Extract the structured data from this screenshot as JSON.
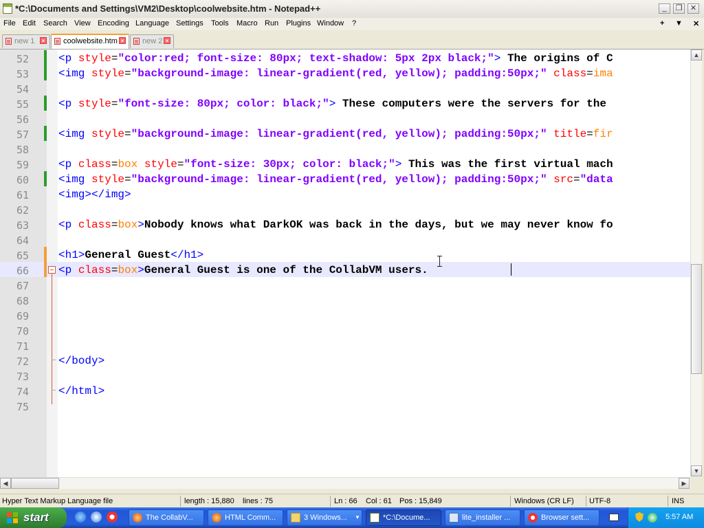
{
  "window": {
    "title": "*C:\\Documents and Settings\\VM2\\Desktop\\coolwebsite.htm - Notepad++",
    "minimize": "_",
    "maximize": "❐",
    "close": "✕"
  },
  "menu": [
    "File",
    "Edit",
    "Search",
    "View",
    "Encoding",
    "Language",
    "Settings",
    "Tools",
    "Macro",
    "Run",
    "Plugins",
    "Window",
    "?"
  ],
  "menu_right": [
    "+",
    "▼",
    "✕"
  ],
  "tabs": [
    {
      "label": "new 1",
      "active": false
    },
    {
      "label": "coolwebsite.htm",
      "active": true
    },
    {
      "label": "new 2",
      "active": false
    }
  ],
  "editor": {
    "lines": [
      {
        "n": "52",
        "segs": [
          [
            "tg",
            "<p "
          ],
          [
            "at",
            "style"
          ],
          [
            "eq",
            "="
          ],
          [
            "st",
            "\"color:red; font-size: 80px; text-shadow: 5px 2px black;\""
          ],
          [
            "tg",
            ">"
          ],
          [
            "tx",
            " The origins of C"
          ]
        ],
        "changed": true
      },
      {
        "n": "53",
        "segs": [
          [
            "tg",
            "<img "
          ],
          [
            "at",
            "style"
          ],
          [
            "eq",
            "="
          ],
          [
            "st",
            "\"background-image: linear-gradient(red, yellow); padding:50px;\""
          ],
          [
            "tg",
            " "
          ],
          [
            "at",
            "class"
          ],
          [
            "eq",
            "="
          ],
          [
            "av",
            "ima"
          ]
        ],
        "changed": true
      },
      {
        "n": "54",
        "segs": [],
        "changed": false
      },
      {
        "n": "55",
        "segs": [
          [
            "tg",
            "<p "
          ],
          [
            "at",
            "style"
          ],
          [
            "eq",
            "="
          ],
          [
            "st",
            "\"font-size: 80px; color: black;\""
          ],
          [
            "tg",
            ">"
          ],
          [
            "tx",
            " These computers were the servers for the"
          ]
        ],
        "changed": true
      },
      {
        "n": "56",
        "segs": [],
        "changed": false
      },
      {
        "n": "57",
        "segs": [
          [
            "tg",
            "<img "
          ],
          [
            "at",
            "style"
          ],
          [
            "eq",
            "="
          ],
          [
            "st",
            "\"background-image: linear-gradient(red, yellow); padding:50px;\""
          ],
          [
            "tg",
            " "
          ],
          [
            "at",
            "title"
          ],
          [
            "eq",
            "="
          ],
          [
            "av",
            "fir"
          ]
        ],
        "changed": true
      },
      {
        "n": "58",
        "segs": [],
        "changed": false
      },
      {
        "n": "59",
        "segs": [
          [
            "tg",
            "<p "
          ],
          [
            "at",
            "class"
          ],
          [
            "eq",
            "="
          ],
          [
            "av",
            "box"
          ],
          [
            "tg",
            " "
          ],
          [
            "at",
            "style"
          ],
          [
            "eq",
            "="
          ],
          [
            "st",
            "\"font-size: 30px; color: black;\""
          ],
          [
            "tg",
            ">"
          ],
          [
            "tx",
            " This was the first virtual mach"
          ]
        ],
        "changed": false
      },
      {
        "n": "60",
        "segs": [
          [
            "tg",
            "<img "
          ],
          [
            "at",
            "style"
          ],
          [
            "eq",
            "="
          ],
          [
            "st",
            "\"background-image: linear-gradient(red, yellow); padding:50px;\""
          ],
          [
            "tg",
            " "
          ],
          [
            "at",
            "src"
          ],
          [
            "eq",
            "="
          ],
          [
            "st",
            "\"data"
          ]
        ],
        "changed": true
      },
      {
        "n": "61",
        "segs": [
          [
            "tg",
            "<img></img>"
          ]
        ],
        "changed": false
      },
      {
        "n": "62",
        "segs": [],
        "changed": false
      },
      {
        "n": "63",
        "segs": [
          [
            "tg",
            "<p "
          ],
          [
            "at",
            "class"
          ],
          [
            "eq",
            "="
          ],
          [
            "av",
            "box"
          ],
          [
            "tg",
            ">"
          ],
          [
            "tx",
            "Nobody knows what DarkOK was back in the days, but we may never know fo"
          ]
        ],
        "changed": false
      },
      {
        "n": "64",
        "segs": [],
        "changed": false
      },
      {
        "n": "65",
        "segs": [
          [
            "tg",
            "<h1>"
          ],
          [
            "tx",
            "General Guest"
          ],
          [
            "tg",
            "</h1>"
          ]
        ],
        "changed": "orange"
      },
      {
        "n": "66",
        "segs": [
          [
            "tg",
            "<p "
          ],
          [
            "at",
            "class"
          ],
          [
            "eq",
            "="
          ],
          [
            "av",
            "box"
          ],
          [
            "tg",
            ">"
          ],
          [
            "tx",
            "General Guest is one of the CollabVM users."
          ]
        ],
        "changed": "orange",
        "current": true
      },
      {
        "n": "67",
        "segs": [],
        "changed": false
      },
      {
        "n": "68",
        "segs": [],
        "changed": false
      },
      {
        "n": "69",
        "segs": [],
        "changed": false
      },
      {
        "n": "70",
        "segs": [],
        "changed": false
      },
      {
        "n": "71",
        "segs": [],
        "changed": false
      },
      {
        "n": "72",
        "segs": [
          [
            "tg",
            "</body>"
          ]
        ],
        "changed": false
      },
      {
        "n": "73",
        "segs": [],
        "changed": false
      },
      {
        "n": "74",
        "segs": [
          [
            "tg",
            "</html>"
          ]
        ],
        "changed": false
      },
      {
        "n": "75",
        "segs": [],
        "changed": false
      }
    ]
  },
  "colors": {
    "saved_change": "#2a9d2a",
    "unsaved_change": "#f2a03a",
    "current_line": "#e8e8ff"
  },
  "status": {
    "file_type": "Hyper Text Markup Language file",
    "length": "length : 15,880",
    "lines": "lines : 75",
    "ln": "Ln : 66",
    "col": "Col : 61",
    "pos": "Pos : 15,849",
    "eol": "Windows (CR LF)",
    "encoding": "UTF-8",
    "mode": "INS"
  },
  "taskbar": {
    "start": "start",
    "tasks": [
      {
        "label": "The CollabV...",
        "icon": "firefox-icon",
        "active": false
      },
      {
        "label": "HTML Comm...",
        "icon": "firefox-icon",
        "active": false
      },
      {
        "label": "3 Windows...",
        "icon": "folder-icon",
        "active": false
      },
      {
        "label": "*C:\\Docume...",
        "icon": "notepadpp-icon",
        "active": true
      },
      {
        "label": "lite_installer ...",
        "icon": "document-icon",
        "active": false
      },
      {
        "label": "Browser sett...",
        "icon": "yandex-icon",
        "active": false
      }
    ],
    "clock": "5:57 AM"
  }
}
